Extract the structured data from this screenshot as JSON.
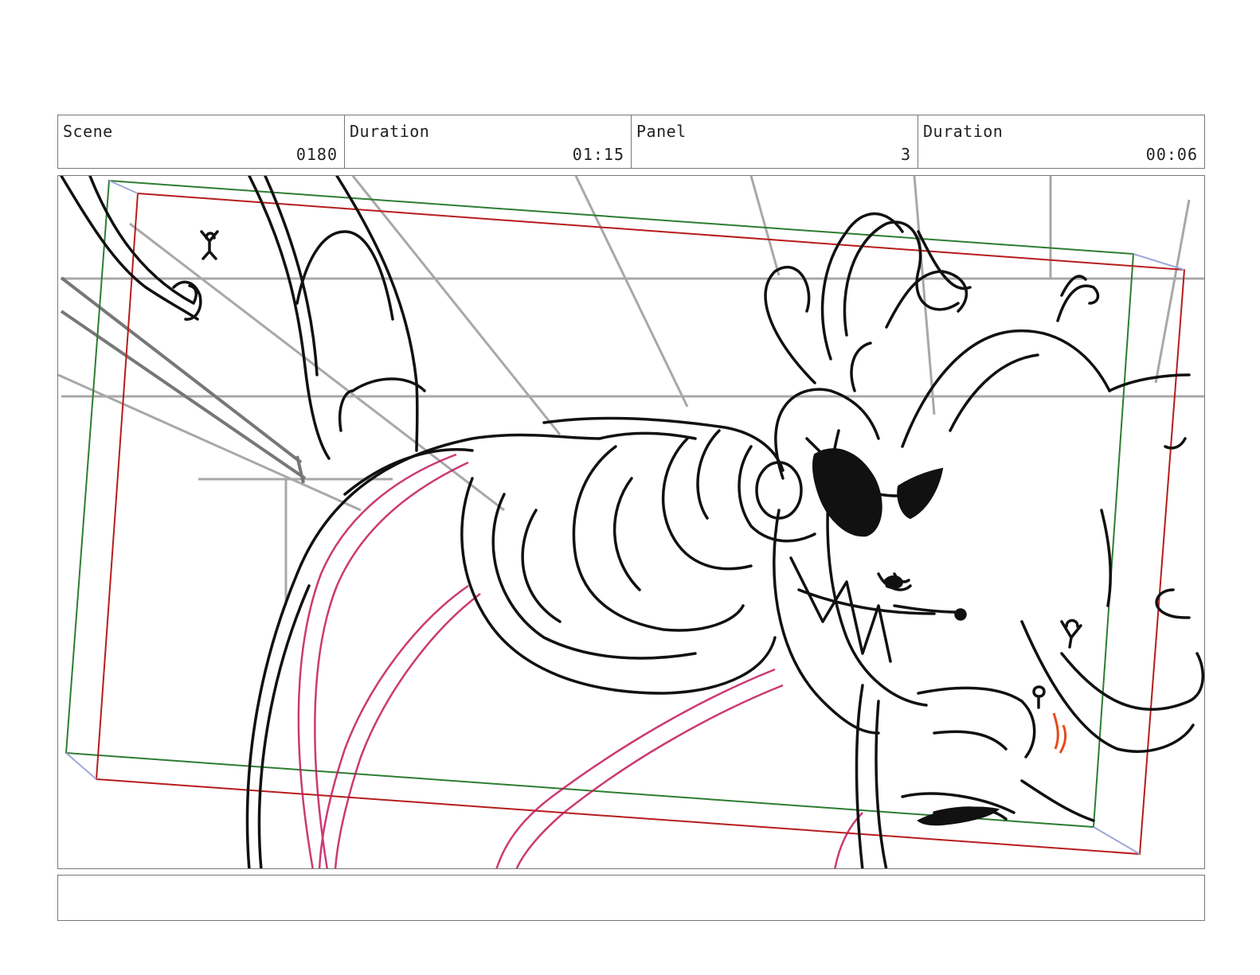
{
  "header": {
    "scene": {
      "label": "Scene",
      "value": "0180"
    },
    "scene_duration": {
      "label": "Duration",
      "value": "01:15"
    },
    "panel": {
      "label": "Panel",
      "value": "3"
    },
    "panel_duration": {
      "label": "Duration",
      "value": "00:06"
    }
  },
  "notes": {
    "text": ""
  },
  "colors": {
    "frame_green": "#2e7d32",
    "frame_red": "#b71c1c",
    "guide_grey": "#a8a8a8",
    "ink": "#111111",
    "accent_pink": "#c2185b",
    "accent_orange": "#e64a19",
    "arrow": "#9fa8da"
  }
}
